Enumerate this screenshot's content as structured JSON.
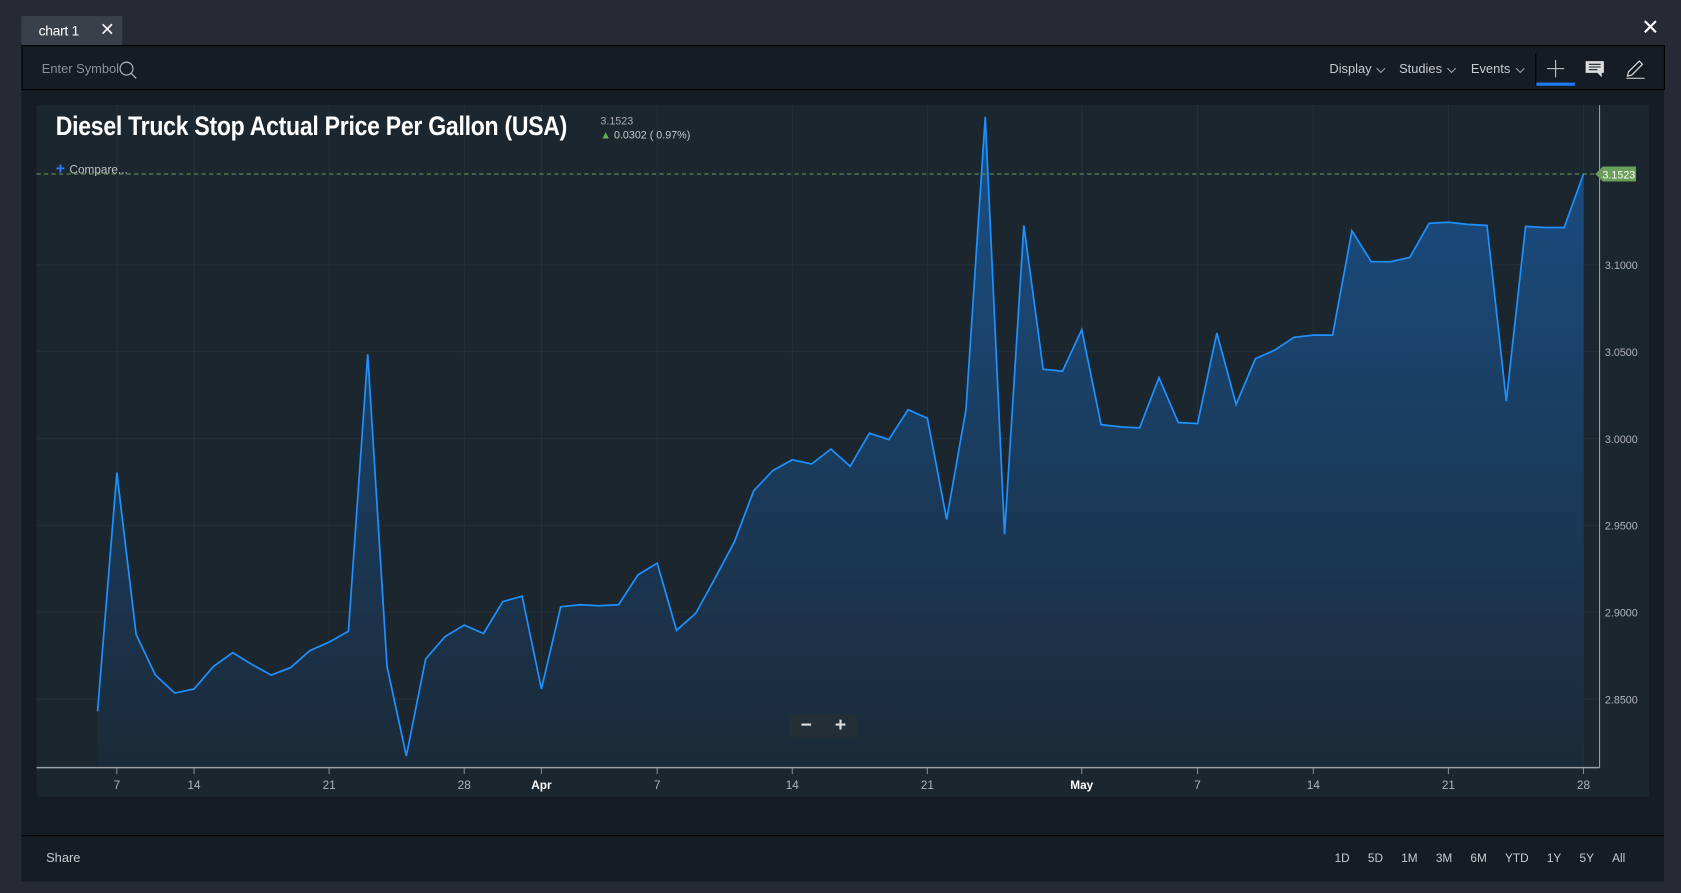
{
  "tab": {
    "label": "chart 1",
    "close_icon": "close-icon"
  },
  "window": {
    "close_icon": "close-icon"
  },
  "toolbar": {
    "symbol_placeholder": "Enter Symbol",
    "menus": [
      {
        "label": "Display"
      },
      {
        "label": "Studies"
      },
      {
        "label": "Events"
      }
    ],
    "icons": [
      "crosshair-icon",
      "comment-icon",
      "pencil-icon"
    ]
  },
  "header": {
    "title": "Diesel Truck Stop Actual Price Per Gallon (USA)",
    "last": "3.1523",
    "change": "0.0302 ( 0.97%)",
    "compare": "Compare..."
  },
  "zoom": {
    "minus": "−",
    "plus": "+"
  },
  "footer": {
    "share": "Share",
    "ranges": [
      "1D",
      "5D",
      "1M",
      "3M",
      "6M",
      "YTD",
      "1Y",
      "5Y",
      "All"
    ]
  },
  "colors": {
    "line": "#1e90ff",
    "fill_top": "#1a4f86",
    "fill_bottom": "#1b2a38",
    "price_tag": "#6a9f5a",
    "up": "#6ab04c",
    "accent": "#1e7bf0"
  },
  "chart_data": {
    "type": "area",
    "title": "Diesel Truck Stop Actual Price Per Gallon (USA)",
    "last_value_label": "3.1523",
    "grid": true,
    "ylim": [
      2.8105,
      3.192
    ],
    "yticks": [
      "2.8500",
      "2.9000",
      "2.9500",
      "3.0000",
      "3.0500",
      "3.1000"
    ],
    "xticks": [
      {
        "label": "7",
        "date": "Mar 7"
      },
      {
        "label": "14",
        "date": "Mar 14"
      },
      {
        "label": "21",
        "date": "Mar 21"
      },
      {
        "label": "28",
        "date": "Mar 28"
      },
      {
        "label": "Apr",
        "date": "Apr 1",
        "major": true
      },
      {
        "label": "7",
        "date": "Apr 7"
      },
      {
        "label": "14",
        "date": "Apr 14"
      },
      {
        "label": "21",
        "date": "Apr 21"
      },
      {
        "label": "May",
        "date": "May 1",
        "major": true
      },
      {
        "label": "7",
        "date": "May 7"
      },
      {
        "label": "14",
        "date": "May 14"
      },
      {
        "label": "21",
        "date": "May 21"
      },
      {
        "label": "28",
        "date": "May 28"
      }
    ],
    "x": [
      "Mar 6",
      "Mar 7",
      "Mar 8",
      "Mar 11",
      "Mar 12",
      "Mar 14",
      "Mar 15",
      "Mar 16",
      "Mar 17",
      "Mar 18",
      "Mar 19",
      "Mar 20",
      "Mar 21",
      "Mar 22",
      "Mar 23",
      "Mar 24",
      "Mar 25",
      "Mar 26",
      "Mar 27",
      "Mar 28",
      "Mar 29",
      "Mar 30",
      "Mar 31",
      "Apr 1",
      "Apr 2",
      "Apr 3",
      "Apr 4",
      "Apr 5",
      "Apr 6",
      "Apr 7",
      "Apr 8",
      "Apr 9",
      "Apr 10",
      "Apr 11",
      "Apr 12",
      "Apr 13",
      "Apr 14",
      "Apr 15",
      "Apr 16",
      "Apr 17",
      "Apr 18",
      "Apr 19",
      "Apr 20",
      "Apr 21",
      "Apr 22",
      "Apr 23",
      "Apr 24",
      "Apr 25",
      "Apr 26",
      "Apr 29",
      "Apr 30",
      "May 1",
      "May 2",
      "May 3",
      "May 4",
      "May 5",
      "May 6",
      "May 7",
      "May 8",
      "May 9",
      "May 10",
      "May 11",
      "May 13",
      "May 14",
      "May 15",
      "May 16",
      "May 17",
      "May 18",
      "May 19",
      "May 20",
      "May 21",
      "May 22",
      "May 23",
      "May 24",
      "May 25",
      "May 26",
      "May 27",
      "May 28"
    ],
    "y": [
      2.8429,
      2.9804,
      2.8871,
      2.8638,
      2.8534,
      2.8558,
      2.8687,
      2.8767,
      2.8699,
      2.8638,
      2.8681,
      2.8779,
      2.8828,
      2.889,
      3.0485,
      2.8687,
      2.8172,
      2.873,
      2.8859,
      2.8926,
      2.8877,
      2.9061,
      2.9092,
      2.8558,
      2.9031,
      2.9043,
      2.9037,
      2.9043,
      2.9215,
      2.9282,
      2.8896,
      2.8994,
      2.9196,
      2.9405,
      2.9699,
      2.9816,
      2.9877,
      2.9853,
      2.9939,
      2.984,
      3.0031,
      2.9994,
      3.0166,
      3.0117,
      2.9534,
      3.0166,
      3.1853,
      2.9448,
      3.1227,
      3.0399,
      3.0387,
      3.0626,
      3.008,
      3.0067,
      3.0061,
      3.035,
      3.0092,
      3.0086,
      3.0607,
      3.0196,
      3.046,
      3.0509,
      3.0583,
      3.0595,
      3.0595,
      3.1196,
      3.1018,
      3.1018,
      3.1043,
      3.1239,
      3.1245,
      3.1233,
      3.1227,
      3.0215,
      3.1221,
      3.1215,
      3.1215,
      3.1523
    ]
  }
}
